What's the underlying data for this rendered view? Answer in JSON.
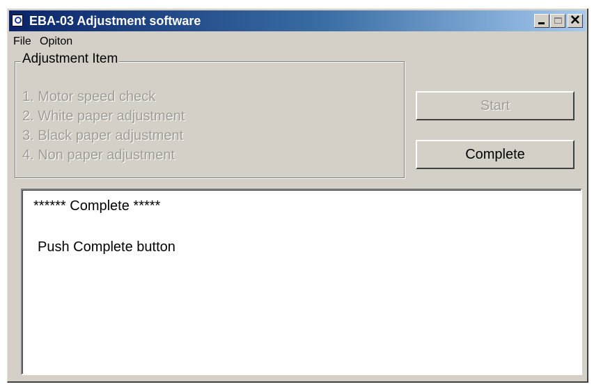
{
  "window": {
    "title": "EBA-03 Adjustment software",
    "icon": "app-icon",
    "controls": [
      "minimize-icon",
      "maximize-icon",
      "close-icon"
    ],
    "close_glyph": "✕"
  },
  "menu": {
    "items": [
      {
        "label": "File"
      },
      {
        "label": "Opiton"
      }
    ]
  },
  "adjustment_group": {
    "legend": "Adjustment Item",
    "items": [
      {
        "label": "1. Motor speed check"
      },
      {
        "label": "2. White paper adjustment"
      },
      {
        "label": "3. Black paper adjustment"
      },
      {
        "label": "4. Non paper adjustment"
      }
    ]
  },
  "buttons": {
    "start_label": "Start",
    "start_enabled": false,
    "complete_label": "Complete",
    "complete_enabled": true
  },
  "log": {
    "lines": [
      "****** Complete *****",
      "Push Complete button"
    ]
  },
  "colors": {
    "titlebar_start": "#0a246a",
    "titlebar_end": "#a6caf0",
    "face": "#d4d0c8",
    "disabled_text": "#a09d96"
  }
}
